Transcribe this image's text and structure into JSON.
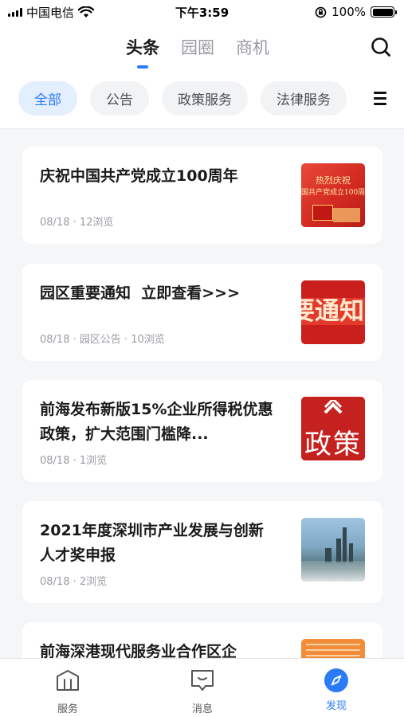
{
  "status_bar": {
    "carrier": "中国电信",
    "time": "下午3:59",
    "battery_level": "100%",
    "battery_fill_fraction": 1.0
  },
  "header": {
    "tabs": [
      {
        "label": "头条",
        "active": true
      },
      {
        "label": "园圈",
        "active": false
      },
      {
        "label": "商机",
        "active": false
      }
    ],
    "search_icon": "search-icon"
  },
  "categories": [
    {
      "label": "全部",
      "active": true
    },
    {
      "label": "公告",
      "active": false
    },
    {
      "label": "政策服务",
      "active": false
    },
    {
      "label": "法律服务",
      "active": false
    }
  ],
  "news": [
    {
      "title": "庆祝中国共产党成立100周年",
      "meta": "08/18 · 12浏览",
      "thumb_text_top": "热烈庆祝",
      "thumb_text_bottom": "国共产党成立100周"
    },
    {
      "title": "园区重要通知  立即查看>>>",
      "meta": "08/18 · 园区公告 · 10浏览",
      "thumb_text": "要通知"
    },
    {
      "title": "前海发布新版15%企业所得税优惠政策，扩大范围门槛降...",
      "meta": "08/18 · 1浏览",
      "thumb_text": "政策"
    },
    {
      "title": "2021年度深圳市产业发展与创新人才奖申报",
      "meta": "08/18 · 2浏览"
    },
    {
      "title": "前海深港现代服务业合作区企"
    }
  ],
  "tabbar": [
    {
      "label": "服务",
      "icon": "building-icon",
      "active": false
    },
    {
      "label": "消息",
      "icon": "message-icon",
      "active": false
    },
    {
      "label": "发现",
      "icon": "compass-icon",
      "active": true
    }
  ],
  "colors": {
    "accent": "#2c7bf6",
    "background": "#f5f6f8"
  }
}
